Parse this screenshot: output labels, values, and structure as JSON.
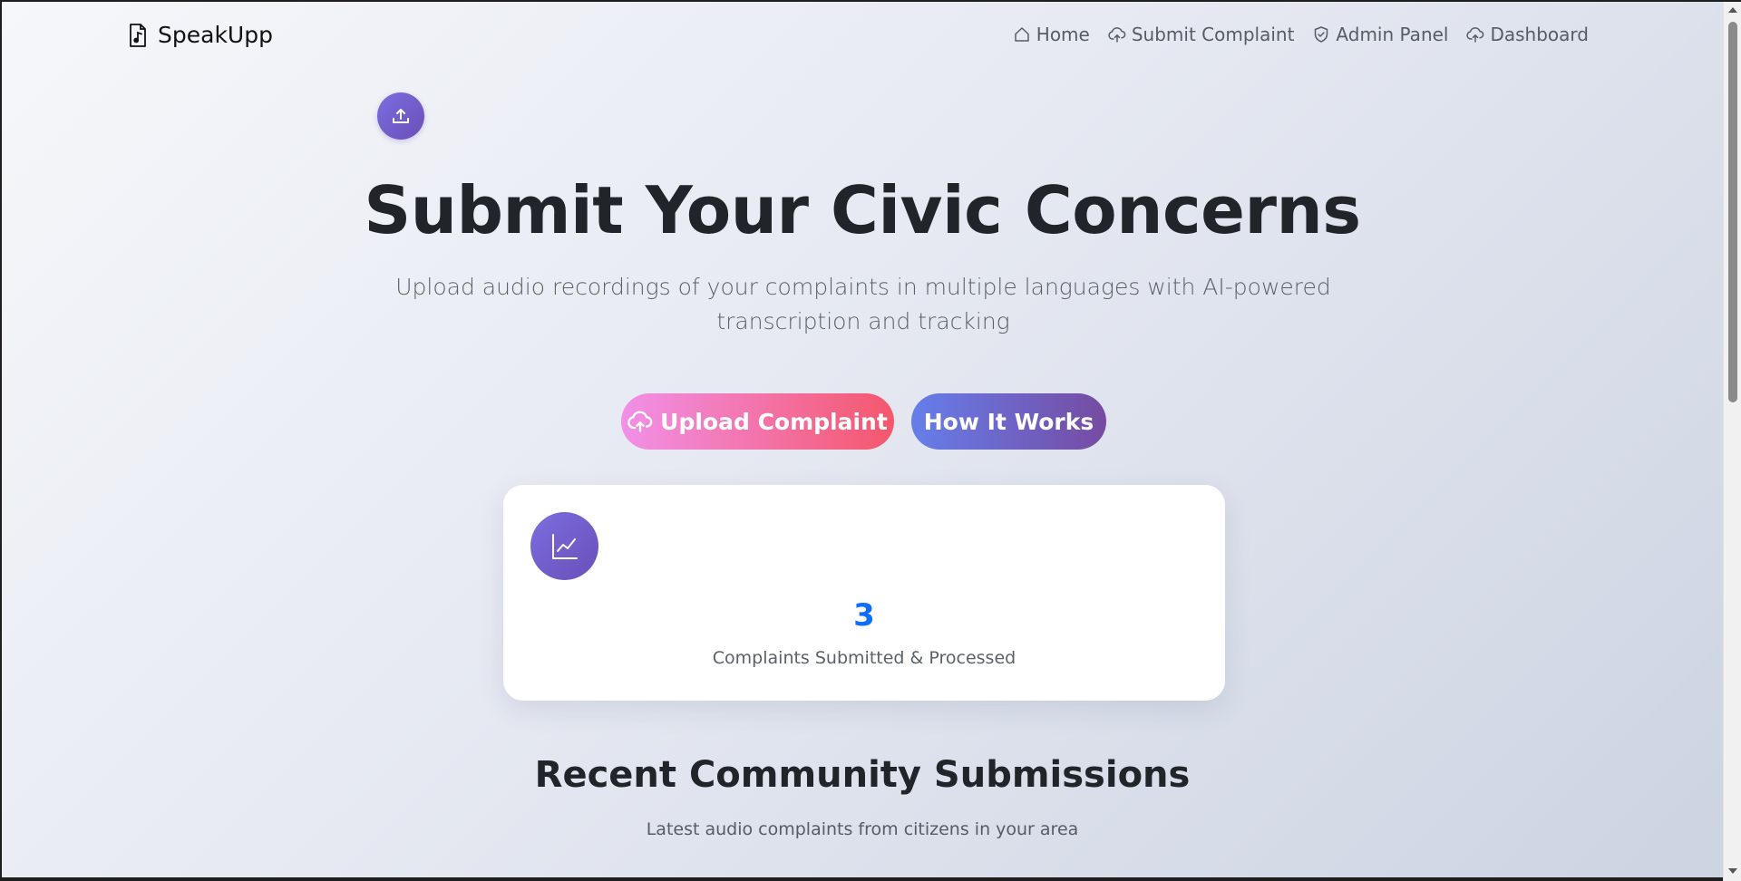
{
  "brand": {
    "name": "SpeakUpp",
    "icon": "music-file-icon"
  },
  "nav": {
    "items": [
      {
        "label": "Home",
        "icon": "home-icon"
      },
      {
        "label": "Submit Complaint",
        "icon": "cloud-upload-icon"
      },
      {
        "label": "Admin Panel",
        "icon": "shield-icon"
      },
      {
        "label": "Dashboard",
        "icon": "cloud-upload-icon"
      }
    ]
  },
  "hero": {
    "icon": "upload-icon",
    "title": "Submit Your Civic Concerns",
    "subtitle": "Upload audio recordings of your complaints in multiple languages with AI-powered transcription and tracking",
    "upload_button": "Upload Complaint",
    "how_button": "How It Works"
  },
  "stats": {
    "icon": "line-chart-icon",
    "number": "3",
    "label": "Complaints Submitted & Processed"
  },
  "recent": {
    "title": "Recent Community Submissions",
    "subtitle": "Latest audio complaints from citizens in your area"
  },
  "colors": {
    "accent_purple": "#6a4fb8",
    "upload_gradient_start": "#f190e8",
    "upload_gradient_end": "#f5576c",
    "how_gradient_start": "#667eea",
    "how_gradient_end": "#764ba2",
    "stat_number": "#0d6efd"
  }
}
